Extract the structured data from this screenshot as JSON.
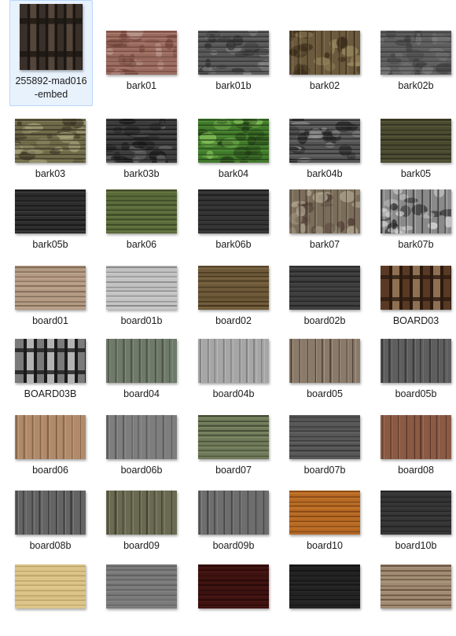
{
  "items": [
    {
      "label": "255892-mad016-embed",
      "selected": true,
      "texture": "fence-dark"
    },
    {
      "label": "bark01",
      "texture": "bark-red"
    },
    {
      "label": "bark01b",
      "texture": "bark-gray"
    },
    {
      "label": "bark02",
      "texture": "bark-brown"
    },
    {
      "label": "bark02b",
      "texture": "bark-gray2"
    },
    {
      "label": "bark03",
      "texture": "bark-moss"
    },
    {
      "label": "bark03b",
      "texture": "bark-dark"
    },
    {
      "label": "bark04",
      "texture": "moss-green"
    },
    {
      "label": "bark04b",
      "texture": "bark-gray3"
    },
    {
      "label": "bark05",
      "texture": "bark-olive"
    },
    {
      "label": "bark05b",
      "texture": "bark-black"
    },
    {
      "label": "bark06",
      "texture": "bark-green"
    },
    {
      "label": "bark06b",
      "texture": "bark-charcoal"
    },
    {
      "label": "bark07",
      "texture": "bark-camo"
    },
    {
      "label": "bark07b",
      "texture": "bark-bw"
    },
    {
      "label": "board01",
      "texture": "board-tan"
    },
    {
      "label": "board01b",
      "texture": "board-white"
    },
    {
      "label": "board02",
      "texture": "board-moss"
    },
    {
      "label": "board02b",
      "texture": "board-dgray"
    },
    {
      "label": "BOARD03",
      "texture": "fence-brown"
    },
    {
      "label": "BOARD03B",
      "texture": "fence-bw"
    },
    {
      "label": "board04",
      "texture": "board-teal"
    },
    {
      "label": "board04b",
      "texture": "board-lgray"
    },
    {
      "label": "board05",
      "texture": "logs"
    },
    {
      "label": "board05b",
      "texture": "board-vgray"
    },
    {
      "label": "board06",
      "texture": "board-natural"
    },
    {
      "label": "board06b",
      "texture": "board-slate"
    },
    {
      "label": "board07",
      "texture": "board-mossgreen"
    },
    {
      "label": "board07b",
      "texture": "board-hgray"
    },
    {
      "label": "board08",
      "texture": "board-red"
    },
    {
      "label": "board08b",
      "texture": "board-gray2"
    },
    {
      "label": "board09",
      "texture": "board-mix"
    },
    {
      "label": "board09b",
      "texture": "board-gray3"
    },
    {
      "label": "board10",
      "texture": "board-orange"
    },
    {
      "label": "board10b",
      "texture": "board-dark"
    },
    {
      "label": "",
      "texture": "board-yellow"
    },
    {
      "label": "",
      "texture": "board-gray4"
    },
    {
      "label": "",
      "texture": "board-mahogany"
    },
    {
      "label": "",
      "texture": "board-black"
    },
    {
      "label": "",
      "texture": "board-stripes"
    }
  ],
  "textures": {
    "fence-dark": {
      "base": "#3a302a",
      "lines": "#1c1612",
      "dir": "v",
      "light": "#5a4a3e",
      "slats": true
    },
    "bark-red": {
      "base": "#9a6a5e",
      "lines": "#6e4036",
      "dir": "h",
      "light": "#c4a49a",
      "blotch": true
    },
    "bark-gray": {
      "base": "#585858",
      "lines": "#2e2e2e",
      "dir": "h",
      "light": "#8a8a8a",
      "blotch": true
    },
    "bark-brown": {
      "base": "#6b5a3e",
      "lines": "#3a2c1a",
      "dir": "v",
      "light": "#9a8a60",
      "blotch": true
    },
    "bark-gray2": {
      "base": "#5e5e5e",
      "lines": "#3a3a3a",
      "dir": "h",
      "light": "#7e7e7e",
      "blotch": true
    },
    "bark-moss": {
      "base": "#6e6a48",
      "lines": "#3a3424",
      "dir": "h",
      "light": "#a6a27a",
      "blotch": true
    },
    "bark-dark": {
      "base": "#3c3c3c",
      "lines": "#161616",
      "dir": "h",
      "light": "#6e6e6e",
      "blotch": true
    },
    "moss-green": {
      "base": "#3f7a2a",
      "lines": "#1f3a14",
      "dir": "h",
      "light": "#86c25a",
      "blotch": true
    },
    "bark-gray3": {
      "base": "#555555",
      "lines": "#222222",
      "dir": "h",
      "light": "#9a9a9a",
      "blotch": true
    },
    "bark-olive": {
      "base": "#4a4a30",
      "lines": "#22221a",
      "dir": "h",
      "light": "#7a7a52",
      "blotch": false
    },
    "bark-black": {
      "base": "#2c2c2c",
      "lines": "#121212",
      "dir": "h",
      "light": "#606060",
      "blotch": false
    },
    "bark-green": {
      "base": "#5a6a3a",
      "lines": "#343e20",
      "dir": "h",
      "light": "#8a9a5a",
      "blotch": false
    },
    "bark-charcoal": {
      "base": "#333333",
      "lines": "#1a1a1a",
      "dir": "h",
      "light": "#4e4e4e",
      "blotch": false
    },
    "bark-camo": {
      "base": "#7a6e5a",
      "lines": "#4e3a34",
      "dir": "v",
      "light": "#b0a890",
      "blotch": true
    },
    "bark-bw": {
      "base": "#8a8a8a",
      "lines": "#2a2a2a",
      "dir": "v",
      "light": "#dcdcdc",
      "blotch": true
    },
    "board-tan": {
      "base": "#b49a82",
      "lines": "#6e5a4a",
      "dir": "h",
      "light": "#d8c4b0",
      "blotch": false
    },
    "board-white": {
      "base": "#c2c2c2",
      "lines": "#7a7a7a",
      "dir": "h",
      "light": "#e6e6e6",
      "blotch": false
    },
    "board-moss": {
      "base": "#6e5a3a",
      "lines": "#3e2e1a",
      "dir": "h",
      "light": "#9a8a52",
      "blotch": false
    },
    "board-dgray": {
      "base": "#3e3e3e",
      "lines": "#222222",
      "dir": "h",
      "light": "#5a5a5a",
      "blotch": false
    },
    "fence-brown": {
      "base": "#5a3a24",
      "lines": "#2a1a10",
      "dir": "v",
      "light": "#9a7a5a",
      "slats": true
    },
    "fence-bw": {
      "base": "#7a7a7a",
      "lines": "#1a1a1a",
      "dir": "v",
      "light": "#bdbdbd",
      "slats": true
    },
    "board-teal": {
      "base": "#6e7a6a",
      "lines": "#4a4a3e",
      "dir": "v",
      "light": "#9aa898",
      "blotch": false
    },
    "board-lgray": {
      "base": "#a6a6a6",
      "lines": "#6e6e6e",
      "dir": "v",
      "light": "#d2d2d2",
      "blotch": false
    },
    "logs": {
      "base": "#8a7a6a",
      "lines": "#3e3228",
      "dir": "v",
      "light": "#c8b8a4",
      "blotch": false
    },
    "board-vgray": {
      "base": "#5e5e5e",
      "lines": "#2e2e2e",
      "dir": "v",
      "light": "#8a8a8a",
      "blotch": false
    },
    "board-natural": {
      "base": "#b08a6a",
      "lines": "#7a5a40",
      "dir": "v",
      "light": "#d4b494",
      "blotch": false
    },
    "board-slate": {
      "base": "#7e7e7e",
      "lines": "#4e4e4e",
      "dir": "v",
      "light": "#9e9e9e",
      "blotch": false
    },
    "board-mossgreen": {
      "base": "#6e7a5a",
      "lines": "#3a3e2a",
      "dir": "h",
      "light": "#a6b07e",
      "blotch": false
    },
    "board-hgray": {
      "base": "#585858",
      "lines": "#303030",
      "dir": "h",
      "light": "#7e7e7e",
      "blotch": false
    },
    "board-red": {
      "base": "#8a5a44",
      "lines": "#4e2e22",
      "dir": "v",
      "light": "#c08a6e",
      "blotch": false
    },
    "board-gray2": {
      "base": "#646464",
      "lines": "#2a2a2a",
      "dir": "v",
      "light": "#9a9a9a",
      "blotch": false
    },
    "board-mix": {
      "base": "#6a6a52",
      "lines": "#3a3a2a",
      "dir": "v",
      "light": "#a4a08a",
      "blotch": false
    },
    "board-gray3": {
      "base": "#6e6e6e",
      "lines": "#3a3a3a",
      "dir": "v",
      "light": "#9a9a9a",
      "blotch": false
    },
    "board-orange": {
      "base": "#b86a22",
      "lines": "#7a3e10",
      "dir": "h",
      "light": "#e0a05a",
      "blotch": false
    },
    "board-dark": {
      "base": "#353535",
      "lines": "#1e1e1e",
      "dir": "h",
      "light": "#4c4c4c",
      "blotch": false
    },
    "board-yellow": {
      "base": "#dcc488",
      "lines": "#b09a5e",
      "dir": "h",
      "light": "#f0e0b0",
      "blotch": false
    },
    "board-gray4": {
      "base": "#7a7a7a",
      "lines": "#5a5a5a",
      "dir": "h",
      "light": "#9a9a9a",
      "blotch": false
    },
    "board-mahogany": {
      "base": "#3e1210",
      "lines": "#200808",
      "dir": "h",
      "light": "#6a2a22",
      "blotch": false
    },
    "board-black": {
      "base": "#222222",
      "lines": "#111111",
      "dir": "h",
      "light": "#3a3a3a",
      "blotch": false
    },
    "board-stripes": {
      "base": "#a08a72",
      "lines": "#5a4636",
      "dir": "h",
      "light": "#d0bca6",
      "blotch": false
    }
  }
}
